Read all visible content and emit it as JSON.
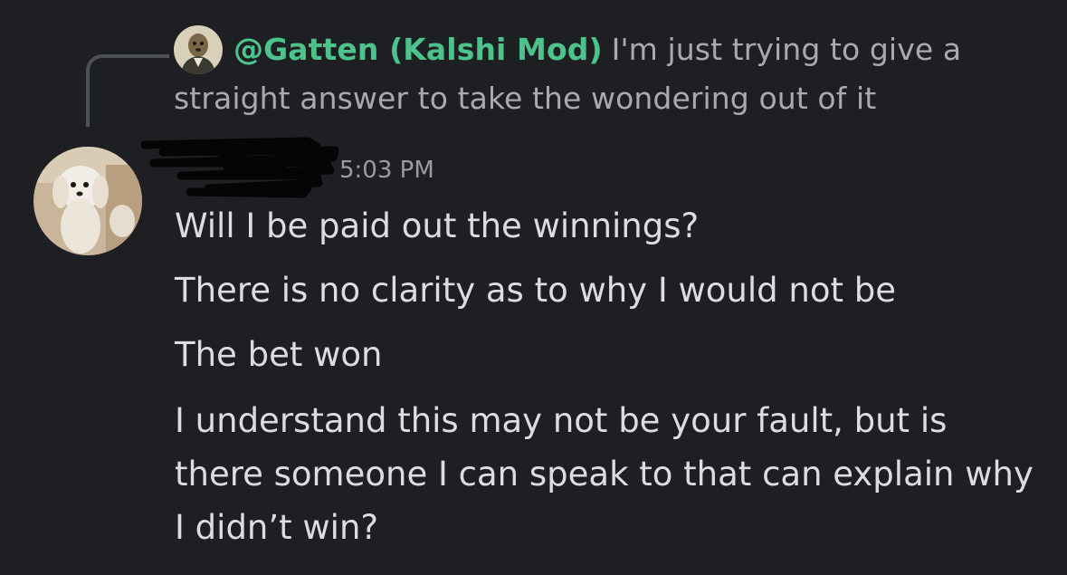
{
  "reply": {
    "author": "@Gatten (Kalshi Mod)",
    "text": "I'm just trying to give a straight answer to take the wondering out of it"
  },
  "message": {
    "author_redacted": "",
    "timestamp": "5:03 PM",
    "lines": [
      "Will I be paid out the winnings?",
      "There is no clarity as to why I would not be",
      "The bet won",
      "I understand this may not be your fault, but is there someone I can speak to that can explain why I didn’t win?"
    ]
  },
  "colors": {
    "background": "#1e1f23",
    "mod_name": "#4cc38a",
    "reply_text": "#a8aab0",
    "message_text": "#dcdde1",
    "timestamp": "#9a9ca3"
  }
}
